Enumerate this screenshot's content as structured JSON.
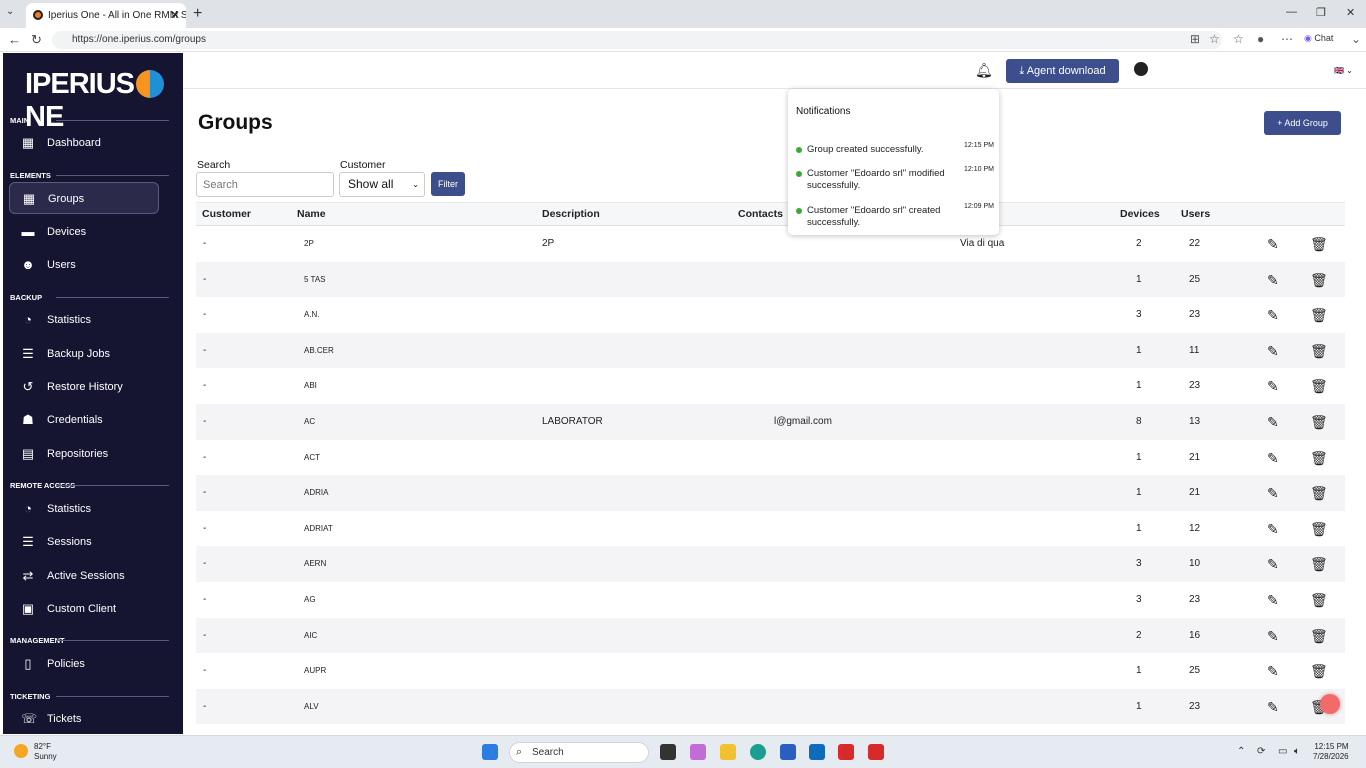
{
  "browser": {
    "tab_title": "Iperius One - All in One RMM Suite",
    "url": "https://one.iperius.com/groups",
    "chat_label": "Chat"
  },
  "sidebar": {
    "logo": "IPERIUS ONE",
    "sections": [
      {
        "title": "MAIN",
        "items": [
          {
            "label": "Dashboard",
            "icon": "dashboard-icon"
          }
        ]
      },
      {
        "title": "ELEMENTS",
        "items": [
          {
            "label": "Groups",
            "icon": "groups-icon",
            "active": true
          },
          {
            "label": "Devices",
            "icon": "monitor-icon"
          },
          {
            "label": "Users",
            "icon": "users-icon"
          }
        ]
      },
      {
        "title": "BACKUP",
        "items": [
          {
            "label": "Statistics",
            "icon": "pie-chart-icon"
          },
          {
            "label": "Backup Jobs",
            "icon": "list-icon"
          },
          {
            "label": "Restore History",
            "icon": "history-icon"
          },
          {
            "label": "Credentials",
            "icon": "user-lock-icon"
          },
          {
            "label": "Repositories",
            "icon": "repository-icon"
          }
        ]
      },
      {
        "title": "REMOTE ACCESS",
        "items": [
          {
            "label": "Statistics",
            "icon": "pie-chart-icon"
          },
          {
            "label": "Sessions",
            "icon": "list-icon"
          },
          {
            "label": "Active Sessions",
            "icon": "arrows-icon"
          },
          {
            "label": "Custom Client",
            "icon": "window-icon"
          }
        ]
      },
      {
        "title": "MANAGEMENT",
        "items": [
          {
            "label": "Policies",
            "icon": "document-icon"
          }
        ]
      },
      {
        "title": "TICKETING",
        "items": [
          {
            "label": "Tickets",
            "icon": "support-icon"
          }
        ]
      }
    ]
  },
  "header": {
    "agent_download": "Agent download"
  },
  "page": {
    "title": "Groups",
    "add_group": "Add Group",
    "search_label": "Search",
    "search_placeholder": "Search",
    "customer_label": "Customer",
    "customer_value": "Show all",
    "filter": "Filter"
  },
  "table": {
    "columns": [
      "Customer",
      "Name",
      "Description",
      "Contacts",
      "Devices",
      "Users"
    ],
    "rows": [
      {
        "customer": "-",
        "name": "2P",
        "description": "2P",
        "contacts": "",
        "address": "Via di qua",
        "devices": "2",
        "users": "22"
      },
      {
        "customer": "-",
        "name": "5 TAS",
        "description": "",
        "contacts": "",
        "address": "",
        "devices": "1",
        "users": "25"
      },
      {
        "customer": "-",
        "name": "A.N.",
        "description": "",
        "contacts": "",
        "address": "",
        "devices": "3",
        "users": "23"
      },
      {
        "customer": "-",
        "name": "AB.CER",
        "description": "",
        "contacts": "",
        "address": "",
        "devices": "1",
        "users": "11"
      },
      {
        "customer": "-",
        "name": "ABI",
        "description": "",
        "contacts": "",
        "address": "",
        "devices": "1",
        "users": "23"
      },
      {
        "customer": "-",
        "name": "AC",
        "description": "LABORATOR",
        "contacts": "l@gmail.com",
        "address": "",
        "devices": "8",
        "users": "13"
      },
      {
        "customer": "-",
        "name": "ACT",
        "description": "",
        "contacts": "",
        "address": "",
        "devices": "1",
        "users": "21"
      },
      {
        "customer": "-",
        "name": "ADRIA",
        "description": "",
        "contacts": "",
        "address": "",
        "devices": "1",
        "users": "21"
      },
      {
        "customer": "-",
        "name": "ADRIAT",
        "description": "",
        "contacts": "",
        "address": "",
        "devices": "1",
        "users": "12"
      },
      {
        "customer": "-",
        "name": "AERN",
        "description": "",
        "contacts": "",
        "address": "",
        "devices": "3",
        "users": "10"
      },
      {
        "customer": "-",
        "name": "AG",
        "description": "",
        "contacts": "",
        "address": "",
        "devices": "3",
        "users": "23"
      },
      {
        "customer": "-",
        "name": "AIC",
        "description": "",
        "contacts": "",
        "address": "",
        "devices": "2",
        "users": "16"
      },
      {
        "customer": "-",
        "name": "AUPR",
        "description": "",
        "contacts": "",
        "address": "",
        "devices": "1",
        "users": "25"
      },
      {
        "customer": "-",
        "name": "ALV",
        "description": "",
        "contacts": "",
        "address": "",
        "devices": "1",
        "users": "23"
      }
    ]
  },
  "notifications": {
    "title": "Notifications",
    "items": [
      {
        "text": "Group created successfully.",
        "time": "12:15 PM"
      },
      {
        "text": "Customer \"Edoardo srl\" modified successfully.",
        "time": "12:10 PM"
      },
      {
        "text": "Customer \"Edoardo srl\" created successfully.",
        "time": "12:09 PM"
      }
    ]
  },
  "taskbar": {
    "temp": "82°F",
    "weather": "Sunny",
    "search": "Search",
    "time": "12:15 PM",
    "date": "7/28/2026"
  }
}
